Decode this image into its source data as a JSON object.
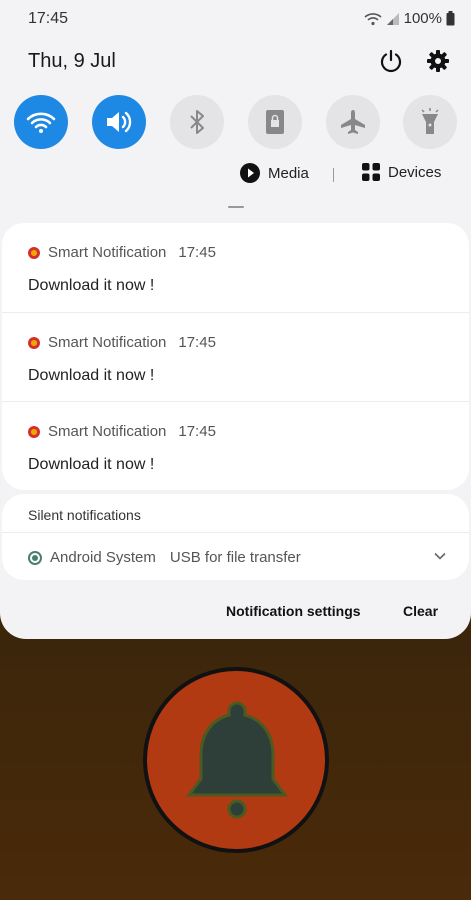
{
  "status_bar": {
    "time": "17:45",
    "battery": "100%"
  },
  "header": {
    "date": "Thu, 9 Jul"
  },
  "quick_settings": [
    {
      "name": "wifi",
      "state": "on"
    },
    {
      "name": "sound",
      "state": "on"
    },
    {
      "name": "bluetooth",
      "state": "off"
    },
    {
      "name": "portrait",
      "state": "off"
    },
    {
      "name": "airplane",
      "state": "off"
    },
    {
      "name": "flashlight",
      "state": "off"
    }
  ],
  "media_bar": {
    "media_label": "Media",
    "devices_label": "Devices"
  },
  "notifications": [
    {
      "app": "Smart Notification",
      "time": "17:45",
      "message": "Download it now !"
    },
    {
      "app": "Smart Notification",
      "time": "17:45",
      "message": "Download it now !"
    },
    {
      "app": "Smart Notification",
      "time": "17:45",
      "message": "Download it now !"
    }
  ],
  "silent": {
    "title": "Silent notifications",
    "app": "Android System",
    "message": "USB for file transfer"
  },
  "footer": {
    "settings_label": "Notification settings",
    "clear_label": "Clear"
  },
  "colors": {
    "accent": "#1e88e5",
    "bell_circle": "#b23a12",
    "bell": "#2e3f3a"
  }
}
